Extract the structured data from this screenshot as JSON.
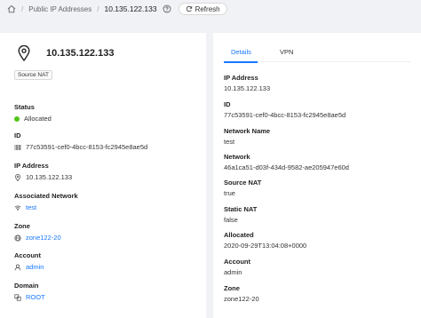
{
  "breadcrumb": {
    "section": "Public IP Addresses",
    "current": "10.135.122.133",
    "refresh_label": "Refresh"
  },
  "summary": {
    "title": "10.135.122.133",
    "tag": "Source NAT",
    "fields": {
      "status": {
        "label": "Status",
        "value": "Allocated"
      },
      "id": {
        "label": "ID",
        "value": "77c53591-cef0-4bcc-8153-fc2945e8ae5d"
      },
      "ip": {
        "label": "IP Address",
        "value": "10.135.122.133"
      },
      "network": {
        "label": "Associated Network",
        "value": "test"
      },
      "zone": {
        "label": "Zone",
        "value": "zone122-20"
      },
      "account": {
        "label": "Account",
        "value": "admin"
      },
      "domain": {
        "label": "Domain",
        "value": "ROOT"
      }
    }
  },
  "tabs": [
    "Details",
    "VPN"
  ],
  "details": [
    {
      "label": "IP Address",
      "value": "10.135.122.133"
    },
    {
      "label": "ID",
      "value": "77c53591-cef0-4bcc-8153-fc2945e8ae5d"
    },
    {
      "label": "Network Name",
      "value": "test"
    },
    {
      "label": "Network",
      "value": "46a1ca51-d03f-434d-9582-ae205947e60d"
    },
    {
      "label": "Source NAT",
      "value": "true"
    },
    {
      "label": "Static NAT",
      "value": "false"
    },
    {
      "label": "Allocated",
      "value": "2020-09-29T13:04:08+0000"
    },
    {
      "label": "Account",
      "value": "admin"
    },
    {
      "label": "Zone",
      "value": "zone122-20"
    }
  ],
  "colors": {
    "accent": "#1677ff",
    "status_ok": "#52c41a"
  }
}
